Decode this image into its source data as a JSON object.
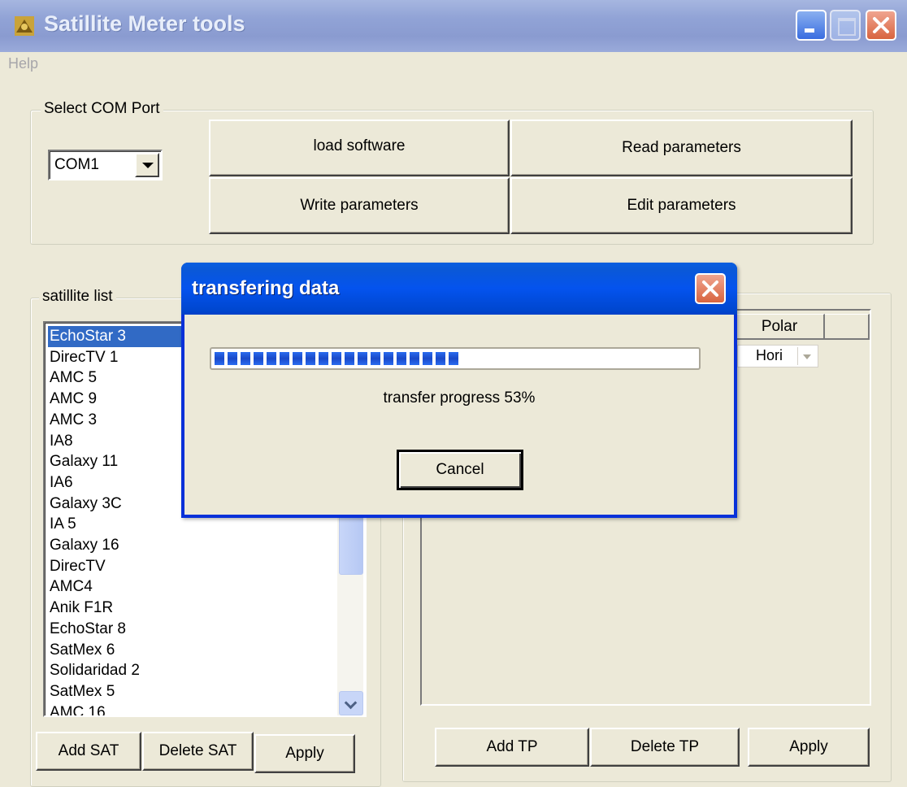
{
  "window": {
    "title": "Satillite Meter tools",
    "app_icon": "satellite-dish-icon",
    "controls": [
      "minimize",
      "maximize",
      "close"
    ]
  },
  "menu": {
    "help": "Help"
  },
  "com_group": {
    "label": "Select COM Port",
    "port_value": "COM1",
    "buttons": {
      "load_software": "load software",
      "read_parameters": "Read parameters",
      "write_parameters": "Write parameters",
      "edit_parameters": "Edit parameters"
    }
  },
  "sat_group": {
    "label": "satillite list",
    "items": [
      "EchoStar 3",
      "DirecTV 1",
      "AMC 5",
      "AMC 9",
      "AMC 3",
      "IA8",
      "Galaxy 11",
      "IA6",
      "Galaxy 3C",
      "IA 5",
      "Galaxy 16",
      "DirecTV",
      "AMC4",
      "Anik F1R",
      "EchoStar 8",
      "SatMex 6",
      "Solidaridad 2",
      "SatMex 5",
      "AMC 16"
    ],
    "selected_index": 0,
    "buttons": {
      "add": "Add SAT",
      "delete": "Delete SAT",
      "apply": "Apply"
    }
  },
  "tp_group": {
    "header_polar": "Polar",
    "row_polar_value": "Hori",
    "buttons": {
      "add": "Add TP",
      "delete": "Delete TP",
      "apply": "Apply"
    }
  },
  "dialog": {
    "title": "transfering data",
    "progress_percent": 53,
    "progress_text": "transfer progress 53%",
    "cancel": "Cancel",
    "colors": {
      "title_bar": "#0453ee",
      "progress_fill": "#1a49c8"
    }
  }
}
